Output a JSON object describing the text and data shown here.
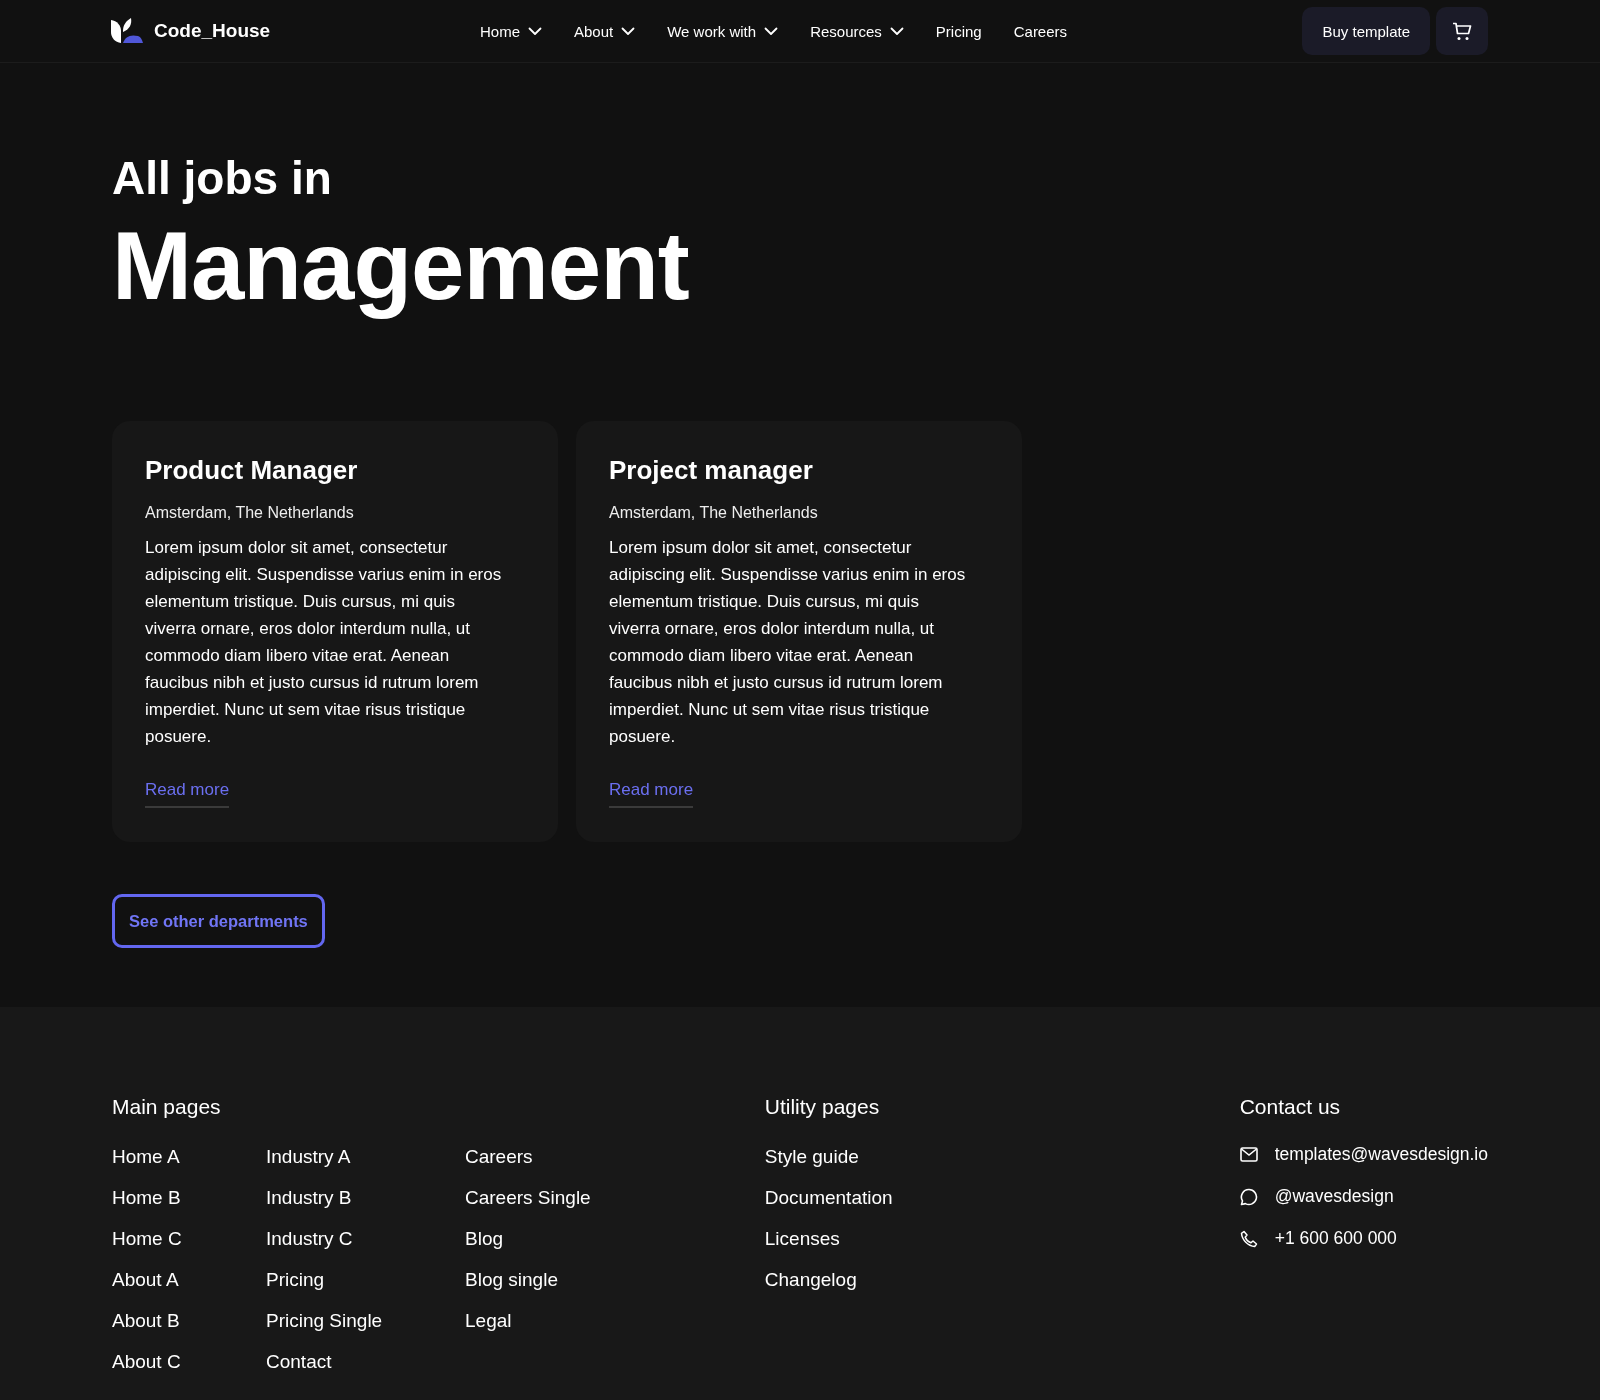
{
  "header": {
    "brand": "Code_House",
    "nav": [
      {
        "label": "Home",
        "dropdown": true
      },
      {
        "label": "About",
        "dropdown": true
      },
      {
        "label": "We work with",
        "dropdown": true
      },
      {
        "label": "Resources",
        "dropdown": true
      },
      {
        "label": "Pricing",
        "dropdown": false
      },
      {
        "label": "Careers",
        "dropdown": false
      }
    ],
    "buy_button": "Buy template"
  },
  "hero": {
    "kicker": "All jobs in",
    "title": "Management"
  },
  "jobs": [
    {
      "title": "Product Manager",
      "location": "Amsterdam, The Netherlands",
      "description": "Lorem ipsum dolor sit amet, consectetur adipiscing elit. Suspendisse varius enim in eros elementum tristique. Duis cursus, mi quis viverra ornare, eros dolor interdum nulla, ut commodo diam libero vitae erat. Aenean faucibus nibh et justo cursus id rutrum lorem imperdiet. Nunc ut sem vitae risus tristique posuere.",
      "link": "Read more"
    },
    {
      "title": "Project manager",
      "location": "Amsterdam, The Netherlands",
      "description": "Lorem ipsum dolor sit amet, consectetur adipiscing elit. Suspendisse varius enim in eros elementum tristique. Duis cursus, mi quis viverra ornare, eros dolor interdum nulla, ut commodo diam libero vitae erat. Aenean faucibus nibh et justo cursus id rutrum lorem imperdiet. Nunc ut sem vitae risus tristique posuere.",
      "link": "Read more"
    }
  ],
  "departments_button": "See other departments",
  "footer": {
    "main_pages": {
      "heading": "Main pages",
      "columns": [
        [
          "Home A",
          "Home B",
          "Home C",
          "About A",
          "About B",
          "About C"
        ],
        [
          "Industry A",
          "Industry B",
          "Industry C",
          "Pricing",
          "Pricing Single",
          "Contact"
        ],
        [
          "Careers",
          "Careers Single",
          "Blog",
          "Blog single",
          "Legal"
        ]
      ]
    },
    "utility_pages": {
      "heading": "Utility pages",
      "links": [
        "Style guide",
        "Documentation",
        "Licenses",
        "Changelog"
      ]
    },
    "contact": {
      "heading": "Contact us",
      "items": [
        {
          "kind": "email",
          "text": "templates@wavesdesign.io"
        },
        {
          "kind": "chat",
          "text": "@wavesdesign"
        },
        {
          "kind": "phone",
          "text": "+1 600 600 000"
        }
      ]
    }
  }
}
